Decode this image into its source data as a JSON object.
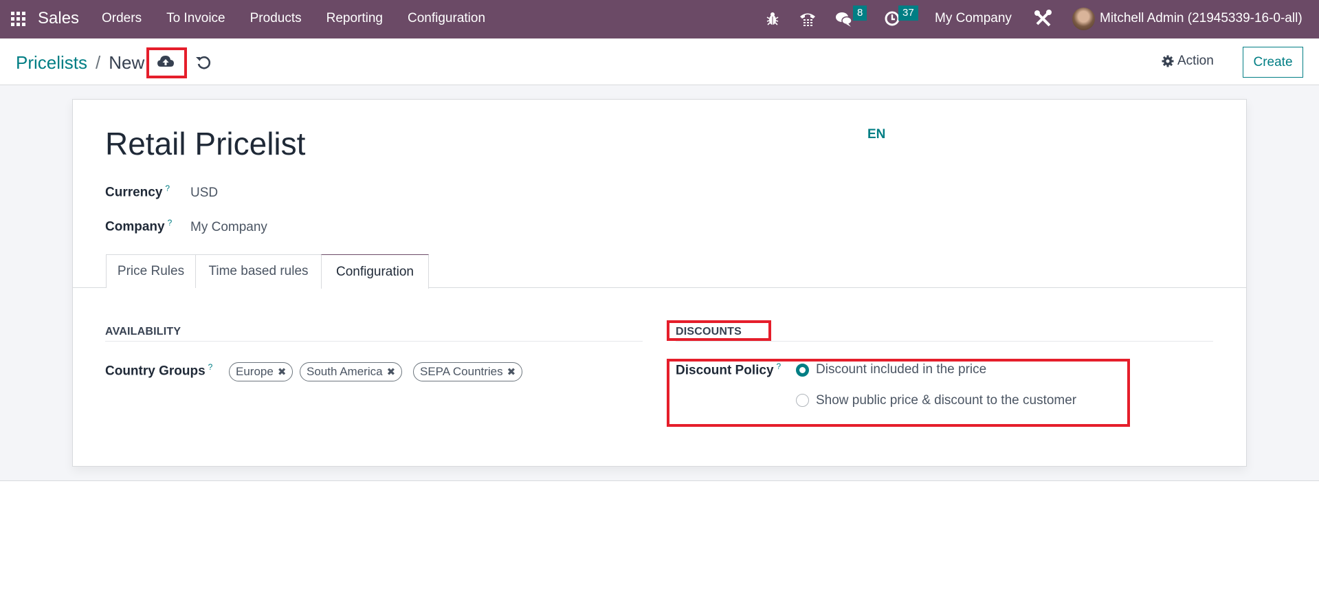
{
  "navbar": {
    "app_name": "Sales",
    "menu": [
      "Orders",
      "To Invoice",
      "Products",
      "Reporting",
      "Configuration"
    ],
    "icons": [
      "bug-icon",
      "phone-icon",
      "chat-icon",
      "clock-icon",
      "tools-icon"
    ],
    "messages_count": "8",
    "activities_count": "37",
    "company": "My Company",
    "user": "Mitchell Admin (21945339-16-0-all)",
    "color": "#6b4a66"
  },
  "control_panel": {
    "breadcrumb_parent": "Pricelists",
    "breadcrumb_sep": "/",
    "breadcrumb_current": "New",
    "action_label": "Action",
    "create_label": "Create"
  },
  "form": {
    "title": "Retail Pricelist",
    "lang": "EN",
    "currency_label": "Currency",
    "currency_value": "USD",
    "company_label": "Company",
    "company_value": "My Company",
    "help_mark": "?",
    "tabs": [
      {
        "label": "Price Rules",
        "active": false
      },
      {
        "label": "Time based rules",
        "active": false
      },
      {
        "label": "Configuration",
        "active": true
      }
    ],
    "availability": {
      "title": "AVAILABILITY",
      "country_groups_label": "Country Groups",
      "tags": [
        "Europe",
        "South America",
        "SEPA Countries"
      ]
    },
    "discounts": {
      "title": "DISCOUNTS",
      "policy_label": "Discount Policy",
      "options": [
        {
          "label": "Discount included in the price",
          "checked": true
        },
        {
          "label": "Show public price & discount to the customer",
          "checked": false
        }
      ]
    }
  },
  "colors": {
    "accent": "#017e84",
    "highlight": "#e51e2b"
  }
}
